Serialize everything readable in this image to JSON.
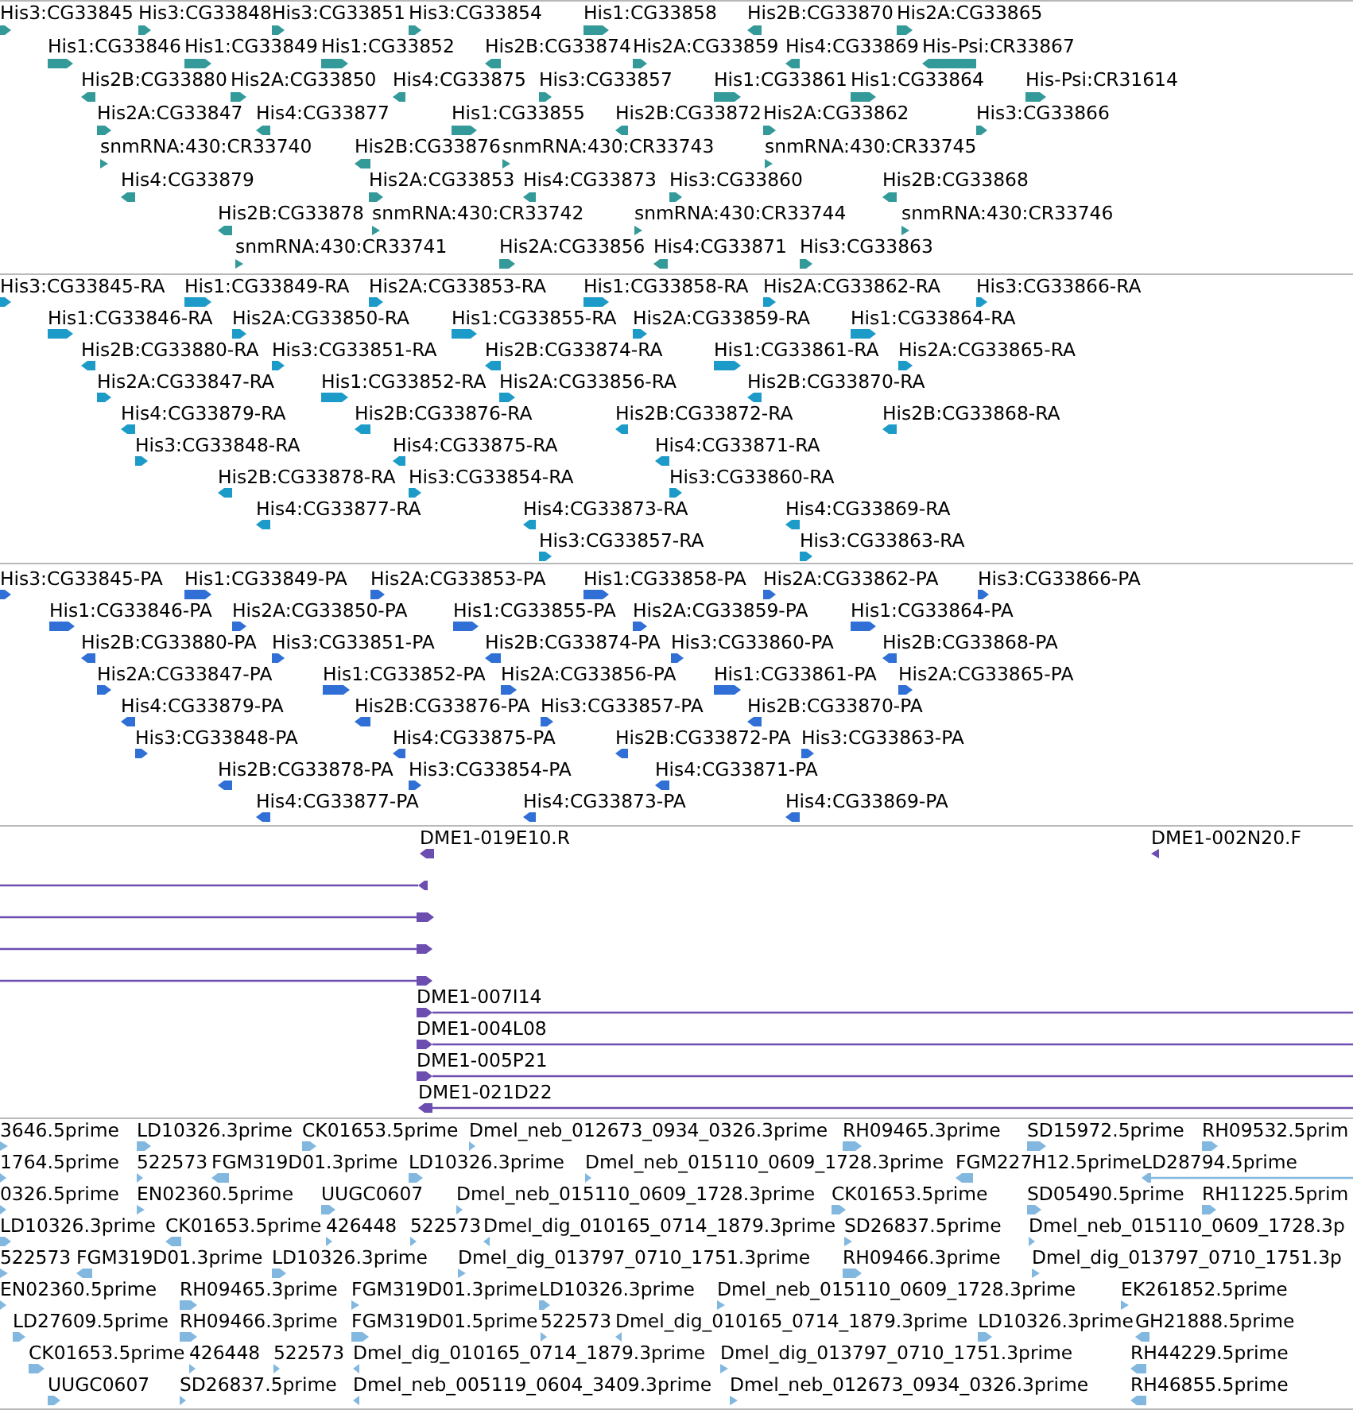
{
  "tracks": [
    {
      "color": "#339999",
      "lanes": [
        {
          "features": [
            {
              "label": "His3:CG33845",
              "reverse": false
            },
            {
              "label": "His3:CG33848",
              "reverse": false
            },
            {
              "label": "His3:CG33851",
              "reverse": false
            },
            {
              "label": "His3:CG33854",
              "reverse": false
            },
            {
              "label": "His1:CG33858",
              "reverse": false
            },
            {
              "label": "His2B:CG33870",
              "reverse": true
            },
            {
              "label": "His2A:CG33865",
              "reverse": false
            }
          ]
        },
        {
          "features": [
            {
              "label": "His1:CG33846",
              "reverse": false
            },
            {
              "label": "His1:CG33849",
              "reverse": false
            },
            {
              "label": "His1:CG33852",
              "reverse": false
            },
            {
              "label": "His2B:CG33874",
              "reverse": true
            },
            {
              "label": "His2A:CG33859",
              "reverse": false
            },
            {
              "label": "His4:CG33869",
              "reverse": true
            },
            {
              "label": "His-Psi:CR33867",
              "reverse": true
            }
          ]
        },
        {
          "features": [
            {
              "label": "His2B:CG33880",
              "reverse": true
            },
            {
              "label": "His2A:CG33850",
              "reverse": false
            },
            {
              "label": "His4:CG33875",
              "reverse": true
            },
            {
              "label": "His3:CG33857",
              "reverse": false
            },
            {
              "label": "His1:CG33861",
              "reverse": false
            },
            {
              "label": "His1:CG33864",
              "reverse": false
            },
            {
              "label": "His-Psi:CR31614",
              "reverse": false
            }
          ]
        },
        {
          "features": [
            {
              "label": "His2A:CG33847",
              "reverse": false
            },
            {
              "label": "His4:CG33877",
              "reverse": true
            },
            {
              "label": "His1:CG33855",
              "reverse": false
            },
            {
              "label": "His2B:CG33872",
              "reverse": true
            },
            {
              "label": "His2A:CG33862",
              "reverse": false
            },
            {
              "label": "His3:CG33866",
              "reverse": false
            }
          ]
        },
        {
          "features": [
            {
              "label": "snmRNA:430:CR33740",
              "reverse": false
            },
            {
              "label": "His2B:CG33876",
              "reverse": true
            },
            {
              "label": "snmRNA:430:CR33743",
              "reverse": false
            },
            {
              "label": "snmRNA:430:CR33745",
              "reverse": false
            }
          ]
        },
        {
          "features": [
            {
              "label": "His4:CG33879",
              "reverse": true
            },
            {
              "label": "His2A:CG33853",
              "reverse": false
            },
            {
              "label": "His4:CG33873",
              "reverse": true
            },
            {
              "label": "His3:CG33860",
              "reverse": false
            },
            {
              "label": "His2B:CG33868",
              "reverse": true
            }
          ]
        },
        {
          "features": [
            {
              "label": "His2B:CG33878",
              "reverse": true
            },
            {
              "label": "snmRNA:430:CR33742",
              "reverse": false
            },
            {
              "label": "snmRNA:430:CR33744",
              "reverse": false
            },
            {
              "label": "snmRNA:430:CR33746",
              "reverse": false
            }
          ]
        },
        {
          "features": [
            {
              "label": "snmRNA:430:CR33741",
              "reverse": false
            },
            {
              "label": "His2A:CG33856",
              "reverse": false
            },
            {
              "label": "His4:CG33871",
              "reverse": true
            },
            {
              "label": "His3:CG33863",
              "reverse": false
            }
          ]
        }
      ]
    },
    {
      "color": "#1c9bc8",
      "lanes": [
        {
          "features": [
            {
              "label": "His3:CG33845-RA",
              "reverse": false
            },
            {
              "label": "His1:CG33849-RA",
              "reverse": false
            },
            {
              "label": "His2A:CG33853-RA",
              "reverse": false
            },
            {
              "label": "His1:CG33858-RA",
              "reverse": false
            },
            {
              "label": "His2A:CG33862-RA",
              "reverse": false
            },
            {
              "label": "His3:CG33866-RA",
              "reverse": false
            }
          ]
        },
        {
          "features": [
            {
              "label": "His1:CG33846-RA",
              "reverse": false
            },
            {
              "label": "His2A:CG33850-RA",
              "reverse": false
            },
            {
              "label": "His1:CG33855-RA",
              "reverse": false
            },
            {
              "label": "His2A:CG33859-RA",
              "reverse": false
            },
            {
              "label": "His1:CG33864-RA",
              "reverse": false
            }
          ]
        },
        {
          "features": [
            {
              "label": "His2B:CG33880-RA",
              "reverse": true
            },
            {
              "label": "His3:CG33851-RA",
              "reverse": false
            },
            {
              "label": "His2B:CG33874-RA",
              "reverse": true
            },
            {
              "label": "His1:CG33861-RA",
              "reverse": false
            },
            {
              "label": "His2A:CG33865-RA",
              "reverse": false
            }
          ]
        },
        {
          "features": [
            {
              "label": "His2A:CG33847-RA",
              "reverse": false
            },
            {
              "label": "His1:CG33852-RA",
              "reverse": false
            },
            {
              "label": "His2A:CG33856-RA",
              "reverse": false
            },
            {
              "label": "His2B:CG33870-RA",
              "reverse": true
            }
          ]
        },
        {
          "features": [
            {
              "label": "His4:CG33879-RA",
              "reverse": true
            },
            {
              "label": "His2B:CG33876-RA",
              "reverse": true
            },
            {
              "label": "His2B:CG33872-RA",
              "reverse": true
            },
            {
              "label": "His2B:CG33868-RA",
              "reverse": true
            }
          ]
        },
        {
          "features": [
            {
              "label": "His3:CG33848-RA",
              "reverse": false
            },
            {
              "label": "His4:CG33875-RA",
              "reverse": true
            },
            {
              "label": "His4:CG33871-RA",
              "reverse": true
            }
          ]
        },
        {
          "features": [
            {
              "label": "His2B:CG33878-RA",
              "reverse": true
            },
            {
              "label": "His3:CG33854-RA",
              "reverse": false
            },
            {
              "label": "His3:CG33860-RA",
              "reverse": false
            }
          ]
        },
        {
          "features": [
            {
              "label": "His4:CG33877-RA",
              "reverse": true
            },
            {
              "label": "His4:CG33873-RA",
              "reverse": true
            },
            {
              "label": "His4:CG33869-RA",
              "reverse": true
            }
          ]
        },
        {
          "features": [
            {
              "label": "His3:CG33857-RA",
              "reverse": false
            },
            {
              "label": "His3:CG33863-RA",
              "reverse": false
            }
          ]
        }
      ]
    },
    {
      "color": "#2f6fd6",
      "lanes": [
        {
          "features": [
            {
              "label": "His3:CG33845-PA",
              "reverse": false
            },
            {
              "label": "His1:CG33849-PA",
              "reverse": false
            },
            {
              "label": "His2A:CG33853-PA",
              "reverse": false
            },
            {
              "label": "His1:CG33858-PA",
              "reverse": false
            },
            {
              "label": "His2A:CG33862-PA",
              "reverse": false
            },
            {
              "label": "His3:CG33866-PA",
              "reverse": false
            }
          ]
        },
        {
          "features": [
            {
              "label": "His1:CG33846-PA",
              "reverse": false
            },
            {
              "label": "His2A:CG33850-PA",
              "reverse": false
            },
            {
              "label": "His1:CG33855-PA",
              "reverse": false
            },
            {
              "label": "His2A:CG33859-PA",
              "reverse": false
            },
            {
              "label": "His1:CG33864-PA",
              "reverse": false
            }
          ]
        },
        {
          "features": [
            {
              "label": "His2B:CG33880-PA",
              "reverse": true
            },
            {
              "label": "His3:CG33851-PA",
              "reverse": false
            },
            {
              "label": "His2B:CG33874-PA",
              "reverse": true
            },
            {
              "label": "His3:CG33860-PA",
              "reverse": false
            },
            {
              "label": "His2B:CG33868-PA",
              "reverse": true
            }
          ]
        },
        {
          "features": [
            {
              "label": "His2A:CG33847-PA",
              "reverse": false
            },
            {
              "label": "His1:CG33852-PA",
              "reverse": false
            },
            {
              "label": "His2A:CG33856-PA",
              "reverse": false
            },
            {
              "label": "His1:CG33861-PA",
              "reverse": false
            },
            {
              "label": "His2A:CG33865-PA",
              "reverse": false
            }
          ]
        },
        {
          "features": [
            {
              "label": "His4:CG33879-PA",
              "reverse": true
            },
            {
              "label": "His2B:CG33876-PA",
              "reverse": true
            },
            {
              "label": "His3:CG33857-PA",
              "reverse": false
            },
            {
              "label": "His2B:CG33870-PA",
              "reverse": true
            }
          ]
        },
        {
          "features": [
            {
              "label": "His3:CG33848-PA",
              "reverse": false
            },
            {
              "label": "His4:CG33875-PA",
              "reverse": true
            },
            {
              "label": "His2B:CG33872-PA",
              "reverse": true
            },
            {
              "label": "His3:CG33863-PA",
              "reverse": false
            }
          ]
        },
        {
          "features": [
            {
              "label": "His2B:CG33878-PA",
              "reverse": true
            },
            {
              "label": "His3:CG33854-PA",
              "reverse": false
            },
            {
              "label": "His4:CG33871-PA",
              "reverse": true
            }
          ]
        },
        {
          "features": [
            {
              "label": "His4:CG33877-PA",
              "reverse": true
            },
            {
              "label": "His4:CG33873-PA",
              "reverse": true
            },
            {
              "label": "His4:CG33869-PA",
              "reverse": true
            }
          ]
        }
      ]
    },
    {
      "color": "#6c4db0",
      "lanes": [
        {
          "features": [
            {
              "label": "DME1-019E10.R",
              "reverse": true
            },
            {
              "label": "DME1-002N20.F",
              "reverse": true
            }
          ]
        },
        {
          "features": [
            {
              "reverse": true
            }
          ]
        },
        {
          "features": [
            {
              "reverse": false
            }
          ]
        },
        {
          "features": [
            {
              "reverse": false
            }
          ]
        },
        {
          "features": [
            {
              "reverse": false
            }
          ]
        },
        {
          "features": [
            {
              "label": "DME1-007I14",
              "reverse": false
            }
          ]
        },
        {
          "features": [
            {
              "label": "DME1-004L08",
              "reverse": false
            }
          ]
        },
        {
          "features": [
            {
              "label": "DME1-005P21",
              "reverse": false
            }
          ]
        },
        {
          "features": [
            {
              "label": "DME1-021D22",
              "reverse": true
            }
          ]
        }
      ]
    },
    {
      "color": "#82b8e0",
      "lanes": [
        {
          "features": [
            {
              "label": "3646.5prime",
              "reverse": false
            },
            {
              "label": "LD10326.3prime",
              "reverse": false
            },
            {
              "label": "CK01653.5prime",
              "reverse": false
            },
            {
              "label": "Dmel_neb_012673_0934_0326.3prime",
              "reverse": false
            },
            {
              "label": "RH09465.3prime",
              "reverse": false
            },
            {
              "label": "SD15972.5prime",
              "reverse": false
            },
            {
              "label": "RH09532.5prim",
              "reverse": false
            }
          ]
        },
        {
          "features": [
            {
              "label": "1764.5prime",
              "reverse": false
            },
            {
              "label": "522573",
              "reverse": false
            },
            {
              "label": "FGM319D01.3prime",
              "reverse": true
            },
            {
              "label": "LD10326.3prime",
              "reverse": false
            },
            {
              "label": "Dmel_neb_015110_0609_1728.3prime",
              "reverse": false
            },
            {
              "label": "FGM227H12.5prime",
              "reverse": true
            },
            {
              "label": "LD28794.5prime",
              "reverse": true
            }
          ]
        },
        {
          "features": [
            {
              "label": "0326.5prime",
              "reverse": false
            },
            {
              "label": "EN02360.5prime",
              "reverse": false
            },
            {
              "label": "UUGC0607",
              "reverse": false
            },
            {
              "label": "Dmel_neb_015110_0609_1728.3prime",
              "reverse": false
            },
            {
              "label": "CK01653.5prime",
              "reverse": false
            },
            {
              "label": "SD05490.5prime",
              "reverse": false
            },
            {
              "label": "RH11225.5prim",
              "reverse": false
            }
          ]
        },
        {
          "features": [
            {
              "label": "LD10326.3prime",
              "reverse": false
            },
            {
              "label": "CK01653.5prime",
              "reverse": true
            },
            {
              "label": "426448",
              "reverse": false
            },
            {
              "label": "522573",
              "reverse": false
            },
            {
              "label": "Dmel_dig_010165_0714_1879.3prime",
              "reverse": true
            },
            {
              "label": "SD26837.5prime",
              "reverse": false
            },
            {
              "label": "Dmel_neb_015110_0609_1728.3p",
              "reverse": false
            }
          ]
        },
        {
          "features": [
            {
              "label": "522573",
              "reverse": false
            },
            {
              "label": "FGM319D01.3prime",
              "reverse": true
            },
            {
              "label": "LD10326.3prime",
              "reverse": false
            },
            {
              "label": "Dmel_dig_013797_0710_1751.3prime",
              "reverse": false
            },
            {
              "label": "RH09466.3prime",
              "reverse": false
            },
            {
              "label": "Dmel_dig_013797_0710_1751.3p",
              "reverse": false
            }
          ]
        },
        {
          "features": [
            {
              "label": "EN02360.5prime",
              "reverse": false
            },
            {
              "label": "RH09465.3prime",
              "reverse": false
            },
            {
              "label": "FGM319D01.3prime",
              "reverse": false
            },
            {
              "label": "LD10326.3prime",
              "reverse": false
            },
            {
              "label": "Dmel_neb_015110_0609_1728.3prime",
              "reverse": false
            },
            {
              "label": "EK261852.5prime",
              "reverse": false
            }
          ]
        },
        {
          "features": [
            {
              "label": "LD27609.5prime",
              "reverse": false
            },
            {
              "label": "RH09466.3prime",
              "reverse": false
            },
            {
              "label": "FGM319D01.5prime",
              "reverse": false
            },
            {
              "label": "522573",
              "reverse": false
            },
            {
              "label": "Dmel_dig_010165_0714_1879.3prime",
              "reverse": true
            },
            {
              "label": "LD10326.3prime",
              "reverse": false
            },
            {
              "label": "GH21888.5prime",
              "reverse": true
            }
          ]
        },
        {
          "features": [
            {
              "label": "CK01653.5prime",
              "reverse": false
            },
            {
              "label": "426448",
              "reverse": false
            },
            {
              "label": "522573",
              "reverse": false
            },
            {
              "label": "Dmel_dig_010165_0714_1879.3prime",
              "reverse": true
            },
            {
              "label": "Dmel_dig_013797_0710_1751.3prime",
              "reverse": false
            },
            {
              "label": "RH44229.5prime",
              "reverse": true
            }
          ]
        },
        {
          "features": [
            {
              "label": "UUGC0607",
              "reverse": false
            },
            {
              "label": "SD26837.5prime",
              "reverse": false
            },
            {
              "label": "Dmel_neb_005119_0604_3409.3prime",
              "reverse": true
            },
            {
              "label": "Dmel_neb_012673_0934_0326.3prime",
              "reverse": false
            },
            {
              "label": "RH46855.5prime",
              "reverse": true
            }
          ]
        }
      ]
    }
  ]
}
